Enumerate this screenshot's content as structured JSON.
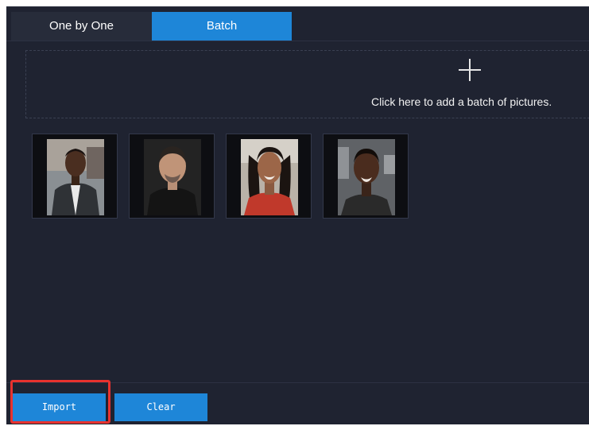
{
  "tabs": [
    {
      "label": "One by One",
      "active": false
    },
    {
      "label": "Batch",
      "active": true
    }
  ],
  "dropzone": {
    "icon": "plus-icon",
    "text": "Click here to add a batch of pictures."
  },
  "thumbnails": [
    {
      "name": "face-photo-1"
    },
    {
      "name": "face-photo-2"
    },
    {
      "name": "face-photo-3"
    },
    {
      "name": "face-photo-4"
    }
  ],
  "footer": {
    "import_label": "Import",
    "clear_label": "Clear"
  },
  "colors": {
    "background": "#1f2331",
    "accent": "#1e86d8",
    "highlight": "#e8322e"
  }
}
